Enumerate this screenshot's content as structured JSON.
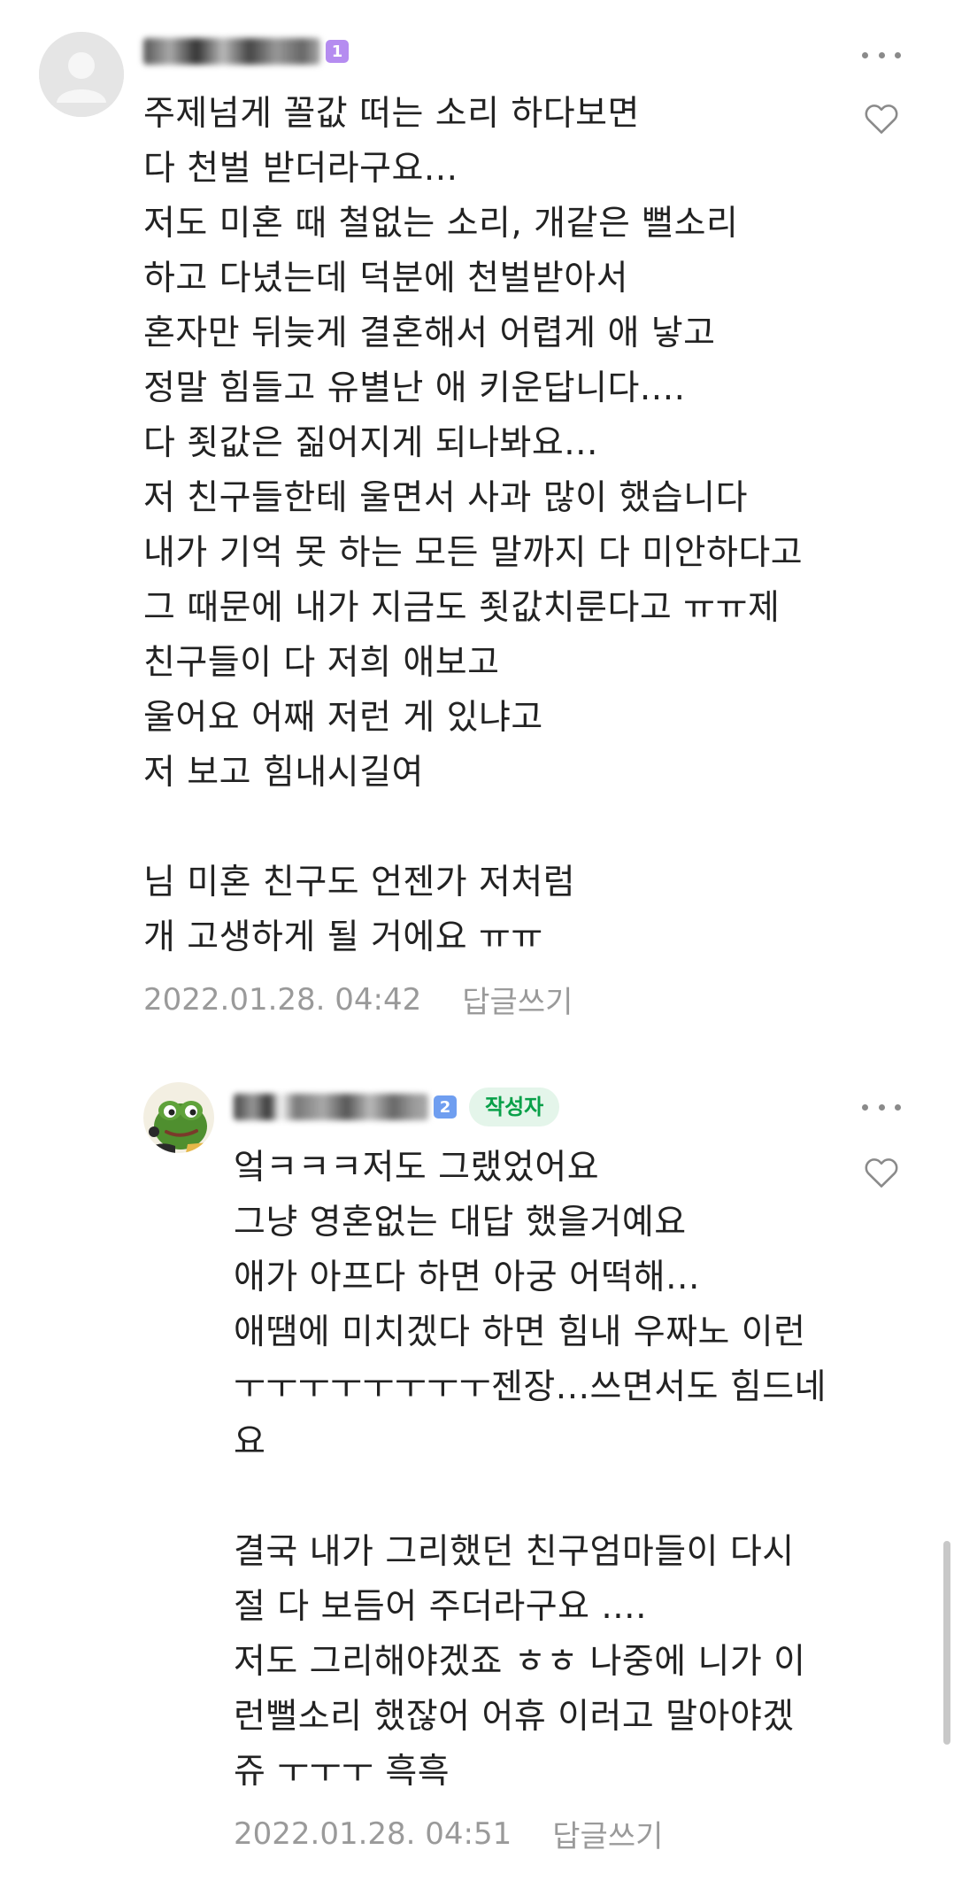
{
  "comments": [
    {
      "level": "1",
      "text": "주제넘게 꼴값 떠는 소리 하다보면\n다 천벌 받더라구요...\n저도 미혼 때 철없는 소리, 개같은 뻘소리\n하고 다녔는데 덕분에 천벌받아서\n혼자만 뒤늦게 결혼해서 어렵게 애 낳고\n정말 힘들고 유별난 애 키운답니다....\n다 죗값은 짊어지게 되나봐요...\n저 친구들한테 울면서 사과 많이 했습니다\n내가 기억 못 하는 모든 말까지 다 미안하다고\n그 때문에 내가 지금도 죗값치룬다고 ㅠㅠ제\n친구들이 다 저희 애보고\n울어요 어째 저런 게 있냐고\n저 보고 힘내시길여\n\n님 미혼 친구도 언젠가 저처럼\n개 고생하게 될 거에요 ㅠㅠ",
      "timestamp": "2022.01.28. 04:42",
      "reply_label": "답글쓰기",
      "badge_color": "#b58cf0"
    },
    {
      "level": "2",
      "author_badge": "작성자",
      "text": "엌ㅋㅋㅋ저도 그랬었어요\n그냥 영혼없는 대답 했을거예요\n애가 아프다 하면 아궁 어떡해...\n애땜에 미치겠다 하면 힘내 우짜노 이런\nㅜㅜㅜㅜㅜㅜㅜㅜ젠장...쓰면서도 힘드네\n요\n\n결국 내가 그리했던 친구엄마들이 다시\n절 다 보듬어 주더라구요 ....\n저도 그리해야겠죠 ㅎㅎ 나중에 니가 이\n런뻘소리 했잖어 어휴 이러고 말아야겠\n쥬 ㅜㅜㅜ 흑흑",
      "timestamp": "2022.01.28. 04:51",
      "reply_label": "답글쓰기",
      "badge_color": "#6f9ef0"
    }
  ],
  "icons": {
    "more": "more-horizontal-icon",
    "like": "heart-outline-icon",
    "avatar_default": "default-user-icon",
    "avatar_frog": "frog-avatar-icon"
  }
}
